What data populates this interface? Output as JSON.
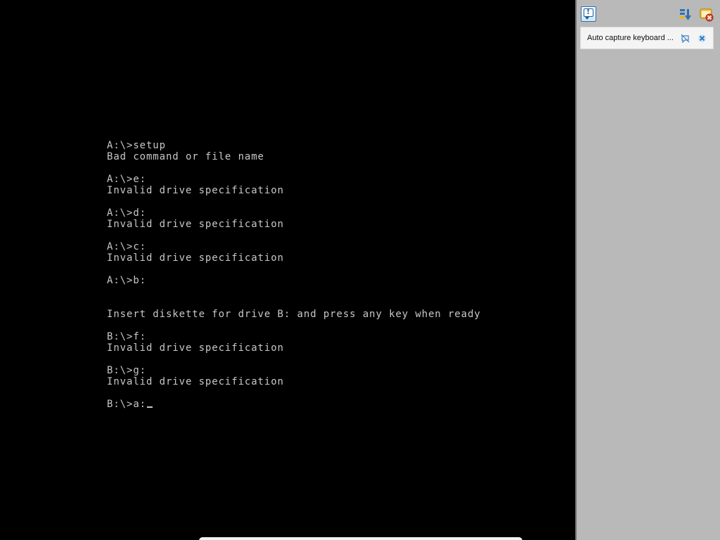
{
  "console": {
    "lines": [
      "A:\\>setup",
      "Bad command or file name",
      "",
      "A:\\>e:",
      "Invalid drive specification",
      "",
      "A:\\>d:",
      "Invalid drive specification",
      "",
      "A:\\>c:",
      "Invalid drive specification",
      "",
      "A:\\>b:",
      "",
      "",
      "Insert diskette for drive B: and press any key when ready",
      "",
      "B:\\>f:",
      "Invalid drive specification",
      "",
      "B:\\>g:",
      "Invalid drive specification",
      "",
      "B:\\>a:"
    ],
    "text_color": "#c8c8c8",
    "background": "#000000"
  },
  "side_panel": {
    "toolbar": {
      "info_icon": "message-bubble-info-icon",
      "order_icon": "sort-order-icon",
      "settings_icon": "notification-settings-icon"
    },
    "notice": {
      "text": "Auto capture keyboard ...",
      "toggle_icon": "toggle-notification-icon",
      "close_icon": "close-icon"
    }
  }
}
